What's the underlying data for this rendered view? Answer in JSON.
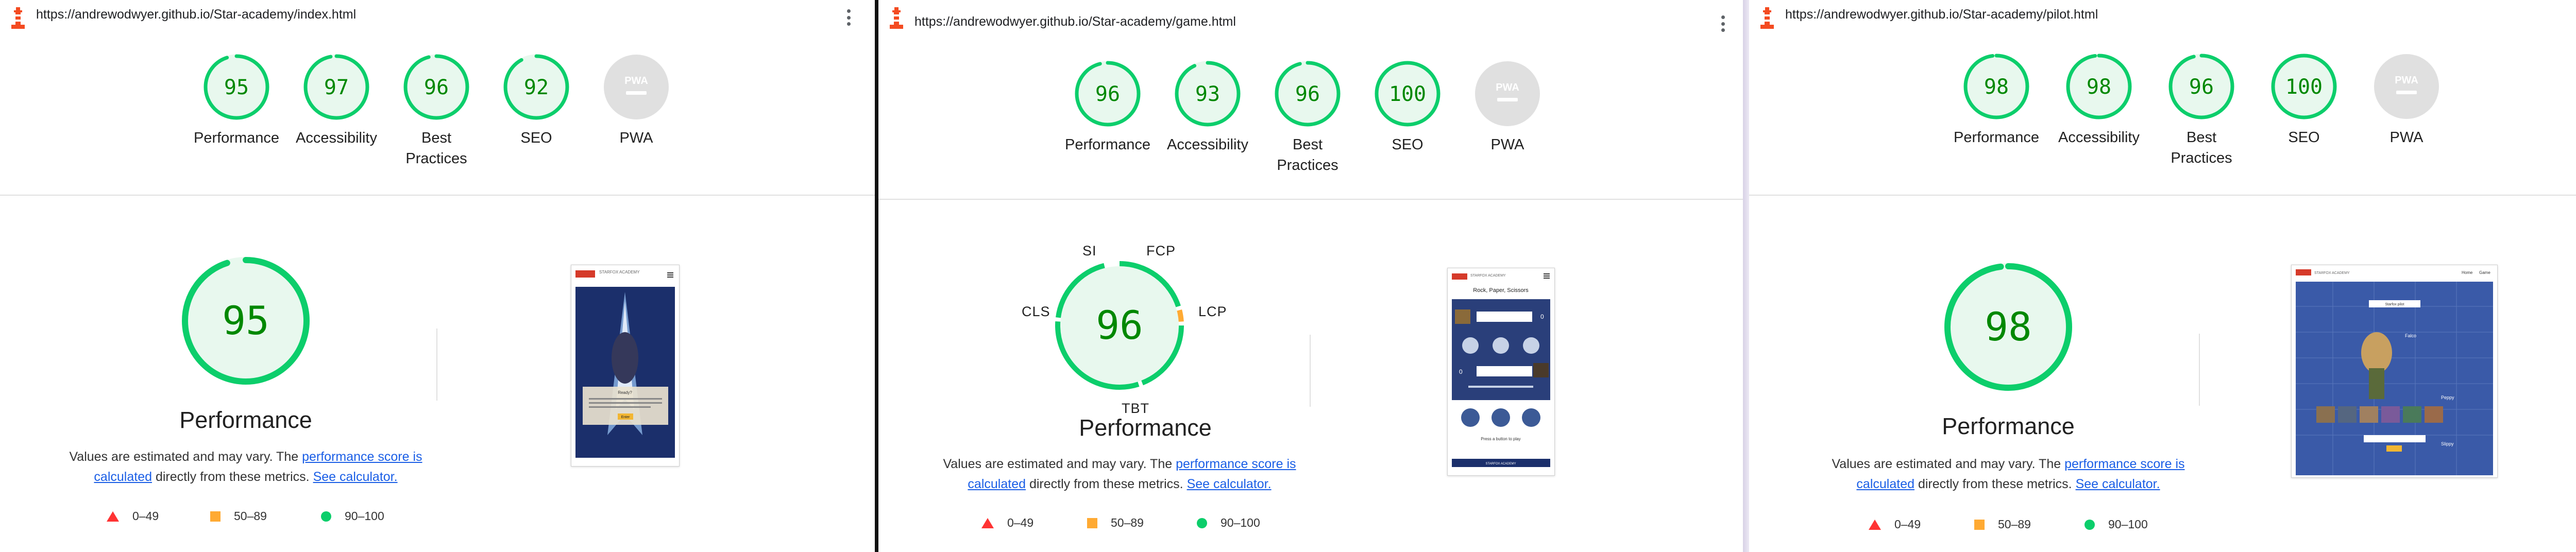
{
  "colors": {
    "pass": "#0cce6b",
    "pass_text": "#008800",
    "pass_fill": "#e8f8ee",
    "average": "#ffaa33",
    "fail": "#ff3333",
    "na": "#999999",
    "na_fill": "#e0e0e0"
  },
  "panels": [
    {
      "url": "https://andrewodwyer.github.io/Star-academy/index.html",
      "scores": [
        {
          "label": "Performance",
          "value": "95",
          "pct": 95
        },
        {
          "label": "Accessibility",
          "value": "97",
          "pct": 97
        },
        {
          "label": "Best Practices",
          "value": "96",
          "pct": 96
        },
        {
          "label": "SEO",
          "value": "92",
          "pct": 92
        },
        {
          "label": "PWA",
          "value": "PWA",
          "pct": 0
        }
      ],
      "performance": {
        "value": "95",
        "pct": 95,
        "title": "Performance"
      },
      "metric_labels": []
    },
    {
      "url": "https://andrewodwyer.github.io/Star-academy/game.html",
      "scores": [
        {
          "label": "Performance",
          "value": "96",
          "pct": 96
        },
        {
          "label": "Accessibility",
          "value": "93",
          "pct": 93
        },
        {
          "label": "Best Practices",
          "value": "96",
          "pct": 96
        },
        {
          "label": "SEO",
          "value": "100",
          "pct": 100
        },
        {
          "label": "PWA",
          "value": "PWA",
          "pct": 0
        }
      ],
      "performance": {
        "value": "96",
        "pct": 96,
        "title": "Performance"
      },
      "metric_labels": [
        "SI",
        "FCP",
        "CLS",
        "LCP",
        "TBT"
      ]
    },
    {
      "url": "https://andrewodwyer.github.io/Star-academy/pilot.html",
      "scores": [
        {
          "label": "Performance",
          "value": "98",
          "pct": 98
        },
        {
          "label": "Accessibility",
          "value": "98",
          "pct": 98
        },
        {
          "label": "Best Practices",
          "value": "96",
          "pct": 96
        },
        {
          "label": "SEO",
          "value": "100",
          "pct": 100
        },
        {
          "label": "PWA",
          "value": "PWA",
          "pct": 0
        }
      ],
      "performance": {
        "value": "98",
        "pct": 98,
        "title": "Performance"
      },
      "metric_labels": []
    }
  ],
  "note": {
    "prefix": "Values are estimated and may vary. The ",
    "link1": "performance score is calculated",
    "middle": " directly from these metrics. ",
    "link2": "See calculator."
  },
  "legend": [
    {
      "label": "0–49",
      "shape": "triangle",
      "color": "#ff3333"
    },
    {
      "label": "50–89",
      "shape": "square",
      "color": "#ffaa33"
    },
    {
      "label": "90–100",
      "shape": "circle",
      "color": "#0cce6b"
    }
  ],
  "thumbnails": [
    {
      "brand": "STARFOX ACADEMY",
      "caption": "Ready?",
      "button": "Enter"
    },
    {
      "brand": "STARFOX ACADEMY",
      "heading": "Rock, Paper, Scissors",
      "score1": "0",
      "score2": "0",
      "prompt": "Press a button to play",
      "footer": "STARFOX ACADEMY"
    },
    {
      "brand": "STARFOX ACADEMY",
      "nav1": "Home",
      "nav2": "Game",
      "tag1": "Starfox pilot",
      "tag2": "Falco",
      "tag3": "Peppy",
      "tag4": "Slippy"
    }
  ]
}
